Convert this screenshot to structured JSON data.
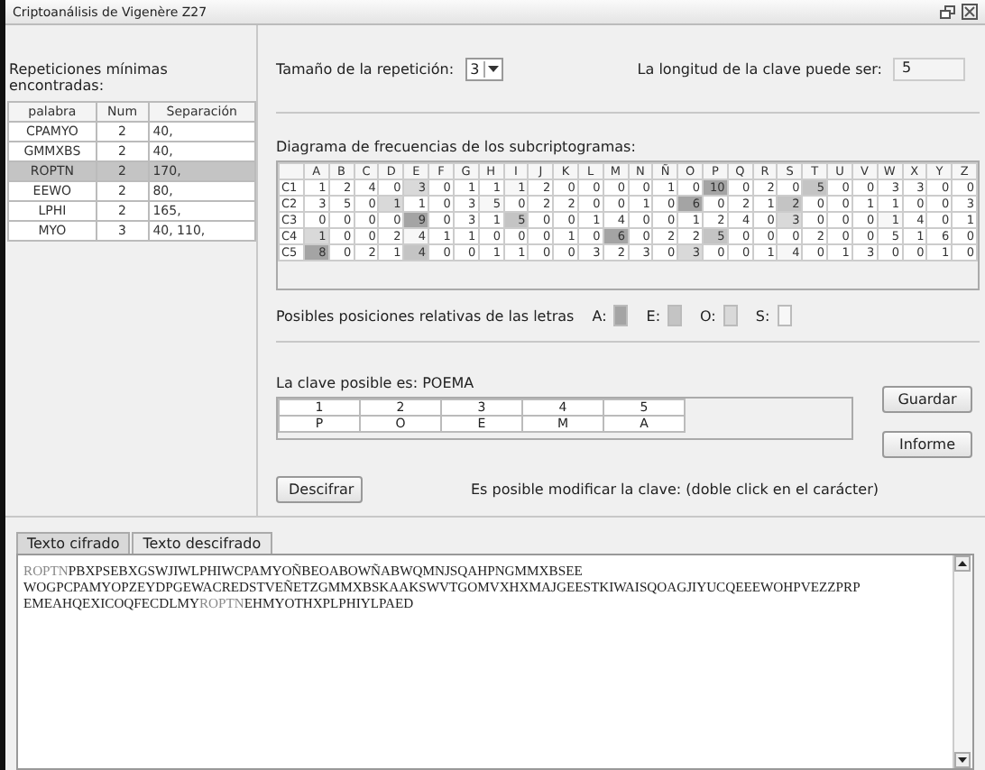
{
  "window": {
    "title": "Criptoanálisis de Vigenère Z27"
  },
  "repetitions": {
    "label": "Repeticiones mínimas encontradas:",
    "columns": [
      "palabra",
      "Num",
      "Separación"
    ],
    "rows": [
      {
        "cells": [
          "CPAMYO",
          "2",
          "40,"
        ],
        "selected": false
      },
      {
        "cells": [
          "GMMXBS",
          "2",
          "40,"
        ],
        "selected": false
      },
      {
        "cells": [
          "ROPTN",
          "2",
          "170,"
        ],
        "selected": true
      },
      {
        "cells": [
          "EEWO",
          "2",
          "80,"
        ],
        "selected": false
      },
      {
        "cells": [
          "LPHI",
          "2",
          "165,"
        ],
        "selected": false
      },
      {
        "cells": [
          "MYO",
          "3",
          "40, 110,"
        ],
        "selected": false
      }
    ]
  },
  "repetition_size": {
    "label": "Tamaño de la repetición:",
    "value": "3"
  },
  "key_length": {
    "label": "La longitud de la clave puede ser:",
    "value": "5"
  },
  "frequency": {
    "label": "Diagrama de frecuencias de los subcriptogramas:",
    "columns": [
      "A",
      "B",
      "C",
      "D",
      "E",
      "F",
      "G",
      "H",
      "I",
      "J",
      "K",
      "L",
      "M",
      "N",
      "Ñ",
      "O",
      "P",
      "Q",
      "R",
      "S",
      "T",
      "U",
      "V",
      "W",
      "X",
      "Y",
      "Z"
    ],
    "rows": [
      {
        "name": "C1",
        "cells": [
          {
            "value": "1"
          },
          {
            "value": "2"
          },
          {
            "value": "4"
          },
          {
            "value": "0"
          },
          {
            "value": "3",
            "color": "#d9d9d9"
          },
          {
            "value": "0"
          },
          {
            "value": "1"
          },
          {
            "value": "1"
          },
          {
            "value": "1",
            "color": "#f7f7f7"
          },
          {
            "value": "2"
          },
          {
            "value": "0"
          },
          {
            "value": "0"
          },
          {
            "value": "0"
          },
          {
            "value": "0"
          },
          {
            "value": "1"
          },
          {
            "value": "0"
          },
          {
            "value": "10",
            "color": "#a4a4a4"
          },
          {
            "value": "0"
          },
          {
            "value": "2"
          },
          {
            "value": "0"
          },
          {
            "value": "5",
            "color": "#c4c4c4"
          },
          {
            "value": "0"
          },
          {
            "value": "0"
          },
          {
            "value": "3"
          },
          {
            "value": "3"
          },
          {
            "value": "0"
          },
          {
            "value": "0"
          }
        ]
      },
      {
        "name": "C2",
        "cells": [
          {
            "value": "3"
          },
          {
            "value": "5"
          },
          {
            "value": "0"
          },
          {
            "value": "1",
            "color": "#d9d9d9"
          },
          {
            "value": "1"
          },
          {
            "value": "0"
          },
          {
            "value": "3"
          },
          {
            "value": "5",
            "color": "#f7f7f7"
          },
          {
            "value": "0"
          },
          {
            "value": "2"
          },
          {
            "value": "2"
          },
          {
            "value": "0"
          },
          {
            "value": "0"
          },
          {
            "value": "1"
          },
          {
            "value": "0"
          },
          {
            "value": "6",
            "color": "#a4a4a4"
          },
          {
            "value": "0"
          },
          {
            "value": "2"
          },
          {
            "value": "1"
          },
          {
            "value": "2",
            "color": "#c4c4c4"
          },
          {
            "value": "0"
          },
          {
            "value": "0"
          },
          {
            "value": "1"
          },
          {
            "value": "1"
          },
          {
            "value": "0"
          },
          {
            "value": "0"
          },
          {
            "value": "3"
          }
        ]
      },
      {
        "name": "C3",
        "cells": [
          {
            "value": "0"
          },
          {
            "value": "0"
          },
          {
            "value": "0"
          },
          {
            "value": "0"
          },
          {
            "value": "9",
            "color": "#a4a4a4"
          },
          {
            "value": "0"
          },
          {
            "value": "3"
          },
          {
            "value": "1"
          },
          {
            "value": "5",
            "color": "#c4c4c4"
          },
          {
            "value": "0"
          },
          {
            "value": "0"
          },
          {
            "value": "1"
          },
          {
            "value": "4"
          },
          {
            "value": "0"
          },
          {
            "value": "0"
          },
          {
            "value": "1"
          },
          {
            "value": "2"
          },
          {
            "value": "4"
          },
          {
            "value": "0"
          },
          {
            "value": "3",
            "color": "#d9d9d9"
          },
          {
            "value": "0"
          },
          {
            "value": "0"
          },
          {
            "value": "0"
          },
          {
            "value": "1",
            "color": "#f7f7f7"
          },
          {
            "value": "4"
          },
          {
            "value": "0"
          },
          {
            "value": "1"
          }
        ]
      },
      {
        "name": "C4",
        "cells": [
          {
            "value": "1",
            "color": "#d9d9d9"
          },
          {
            "value": "0"
          },
          {
            "value": "0"
          },
          {
            "value": "2"
          },
          {
            "value": "4",
            "color": "#f7f7f7"
          },
          {
            "value": "1"
          },
          {
            "value": "1"
          },
          {
            "value": "0"
          },
          {
            "value": "0"
          },
          {
            "value": "0"
          },
          {
            "value": "1"
          },
          {
            "value": "0"
          },
          {
            "value": "6",
            "color": "#a4a4a4"
          },
          {
            "value": "0"
          },
          {
            "value": "2"
          },
          {
            "value": "2"
          },
          {
            "value": "5",
            "color": "#c4c4c4"
          },
          {
            "value": "0"
          },
          {
            "value": "0"
          },
          {
            "value": "0"
          },
          {
            "value": "2"
          },
          {
            "value": "0"
          },
          {
            "value": "0"
          },
          {
            "value": "5"
          },
          {
            "value": "1"
          },
          {
            "value": "6"
          },
          {
            "value": "0"
          }
        ]
      },
      {
        "name": "C5",
        "cells": [
          {
            "value": "8",
            "color": "#a4a4a4"
          },
          {
            "value": "0"
          },
          {
            "value": "2"
          },
          {
            "value": "1"
          },
          {
            "value": "4",
            "color": "#c4c4c4"
          },
          {
            "value": "0"
          },
          {
            "value": "0"
          },
          {
            "value": "1"
          },
          {
            "value": "1"
          },
          {
            "value": "0"
          },
          {
            "value": "0"
          },
          {
            "value": "3"
          },
          {
            "value": "2"
          },
          {
            "value": "3"
          },
          {
            "value": "0"
          },
          {
            "value": "3",
            "color": "#d9d9d9"
          },
          {
            "value": "0"
          },
          {
            "value": "0"
          },
          {
            "value": "1"
          },
          {
            "value": "4",
            "color": "#f7f7f7"
          },
          {
            "value": "0"
          },
          {
            "value": "1"
          },
          {
            "value": "3"
          },
          {
            "value": "0"
          },
          {
            "value": "0"
          },
          {
            "value": "1"
          },
          {
            "value": "0"
          }
        ]
      }
    ]
  },
  "legend": {
    "label": "Posibles posiciones relativas de las letras",
    "items": [
      {
        "label": "A:",
        "color": "#a4a4a4"
      },
      {
        "label": "E:",
        "color": "#c4c4c4"
      },
      {
        "label": "O:",
        "color": "#d9d9d9"
      },
      {
        "label": "S:",
        "color": "#f7f7f7"
      }
    ]
  },
  "key": {
    "label": "La clave posible es: POEMA",
    "positions": [
      "1",
      "2",
      "3",
      "4",
      "5"
    ],
    "letters": [
      "P",
      "O",
      "E",
      "M",
      "A"
    ]
  },
  "buttons": {
    "save": "Guardar",
    "report": "Informe",
    "decrypt": "Descifrar"
  },
  "hint": "Es posible modificar la clave: (doble click en el carácter)",
  "tabs": [
    {
      "label": "Texto cifrado",
      "selected": true
    },
    {
      "label": "Texto descifrado",
      "selected": false
    }
  ],
  "ciphertext": [
    [
      {
        "text": "ROPTN",
        "highlight": true
      },
      {
        "text": "PBXPSEBXGSWJIWLPHIWCPAMYOÑBEOABOWÑABWQMNJSQAHPNGMMXBSEE",
        "highlight": false
      }
    ],
    [
      {
        "text": "WOGPCPAMYOPZEYDPGEWACREDSTVEÑETZGMMXBSKAAKSWVTGOMVXHXMAJGEESTKIWAISQOAGJIYUCQEEEWOHPVEZZPRP",
        "highlight": false
      }
    ],
    [
      {
        "text": "EMEAHQEXICOQFECDLMY",
        "highlight": false
      },
      {
        "text": "ROPTN",
        "highlight": true
      },
      {
        "text": "EHMYOTHXPLPHIYLPAED",
        "highlight": false
      }
    ]
  ]
}
